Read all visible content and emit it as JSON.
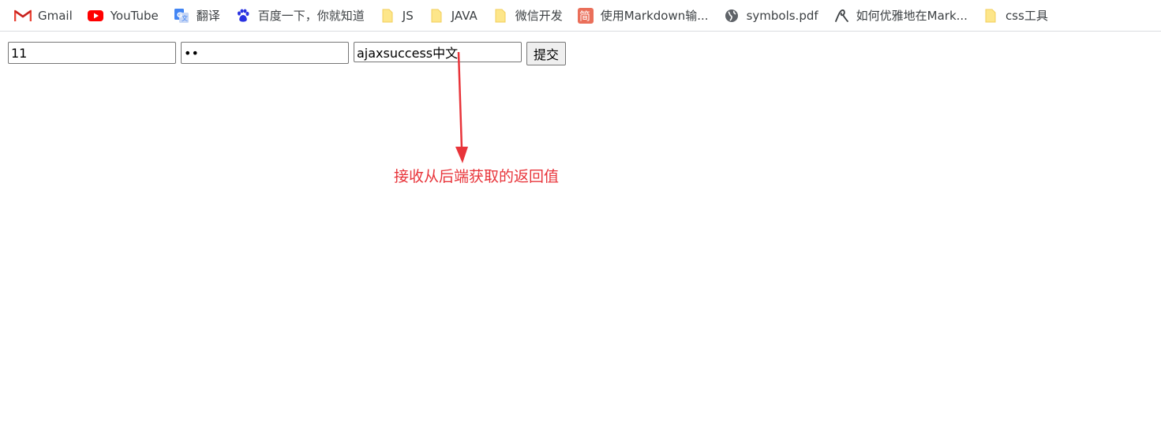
{
  "bookmarks": [
    {
      "label": "Gmail",
      "icon": "gmail-icon"
    },
    {
      "label": "YouTube",
      "icon": "youtube-icon"
    },
    {
      "label": "翻译",
      "icon": "translate-icon"
    },
    {
      "label": "百度一下，你就知道",
      "icon": "baidu-paw-icon"
    },
    {
      "label": "JS",
      "icon": "folder-icon"
    },
    {
      "label": "JAVA",
      "icon": "folder-icon"
    },
    {
      "label": "微信开发",
      "icon": "folder-icon"
    },
    {
      "label": "使用Markdown输...",
      "icon": "jianshu-icon"
    },
    {
      "label": "symbols.pdf",
      "icon": "globe-icon"
    },
    {
      "label": "如何优雅地在Mark...",
      "icon": "site-logo-icon"
    },
    {
      "label": "css工具",
      "icon": "folder-icon"
    }
  ],
  "form": {
    "field1_value": "11",
    "field2_value": "••",
    "field3_value": "ajaxsuccess中文",
    "submit_label": "提交"
  },
  "annotation": {
    "text": "接收从后端获取的返回值",
    "color": "#e8343a"
  },
  "colors": {
    "bookmark_text": "#3c4043",
    "folder": "#f7d774",
    "gmail_red": "#ea4335",
    "youtube_red": "#ff0000",
    "translate_blue": "#4285f4",
    "baidu_blue": "#2932e1",
    "jianshu_red": "#ea6f5a"
  }
}
